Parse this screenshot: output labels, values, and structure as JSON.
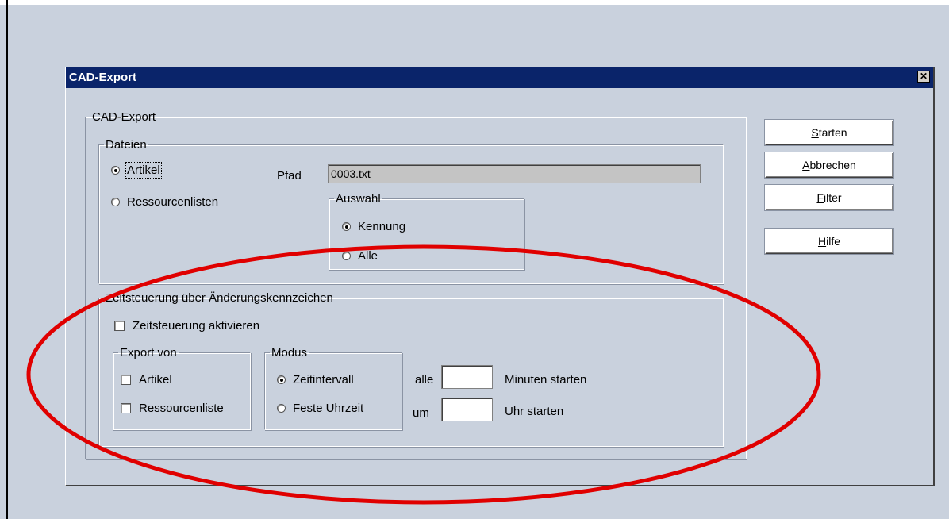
{
  "dialog": {
    "title": "CAD-Export",
    "close_glyph": "✕"
  },
  "cad_group": {
    "legend": "CAD-Export"
  },
  "dateien": {
    "legend": "Dateien",
    "artikel_label": "Artikel",
    "ressourcen_label": "Ressourcenlisten",
    "pfad_label": "Pfad",
    "pfad_value": "0003.txt",
    "selected": "Artikel"
  },
  "auswahl": {
    "legend": "Auswahl",
    "kennung_label": "Kennung",
    "alle_label": "Alle",
    "selected": "Kennung"
  },
  "zeit": {
    "legend": "Zeitsteuerung über Änderungskennzeichen",
    "aktivieren_label": "Zeitsteuerung aktivieren",
    "aktivieren_checked": false
  },
  "export_von": {
    "legend": "Export von",
    "artikel_label": "Artikel",
    "ressourcenliste_label": "Ressourcenliste"
  },
  "modus": {
    "legend": "Modus",
    "zeitintervall_label": "Zeitintervall",
    "feste_label": "Feste Uhrzeit",
    "selected": "Zeitintervall"
  },
  "interval": {
    "alle_label": "alle",
    "alle_value": "",
    "minuten_label": "Minuten starten",
    "um_label": "um",
    "um_value": "",
    "uhr_label": "Uhr starten"
  },
  "buttons": {
    "starten_acc": "S",
    "starten_rest": "tarten",
    "abbrechen_acc": "A",
    "abbrechen_rest": "bbrechen",
    "filter_acc": "F",
    "filter_rest": "ilter",
    "hilfe_acc": "H",
    "hilfe_rest": "ilfe"
  },
  "colors": {
    "titlebar": "#0a246a",
    "background": "#c9d1dd",
    "annotation_ellipse": "#e00000"
  }
}
